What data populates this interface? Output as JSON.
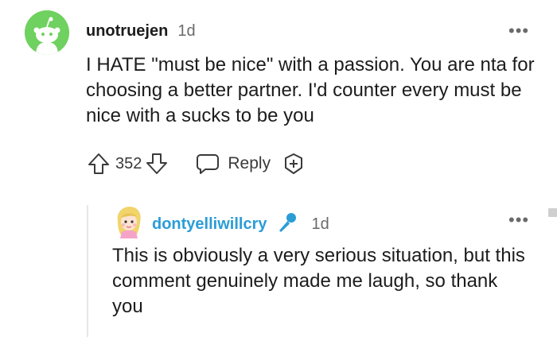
{
  "comment": {
    "author": "unotruejen",
    "time": "1d",
    "body": "I HATE \"must be nice\" with a passion. You are nta for choosing a better partner. I'd counter every must be nice with a sucks to be you",
    "votes": "352",
    "reply_label": "Reply",
    "more_label": "•••"
  },
  "reply": {
    "author": "dontyelliwillcry",
    "time": "1d",
    "body": "This is obviously a very serious situation, but this comment genuinely made me laugh, so thank you",
    "more_label": "•••"
  },
  "colors": {
    "avatar_green": "#6fd15f",
    "reply_author_blue": "#2b9dd6",
    "mic_blue": "#2b9dd6",
    "text": "#1c1c1c",
    "muted": "#6a6a6a"
  },
  "icons": {
    "upvote": "upvote-arrow-icon",
    "downvote": "downvote-arrow-icon",
    "reply": "speech-bubble-icon",
    "award": "add-award-icon",
    "mic": "microphone-icon",
    "more": "more-dots-icon"
  }
}
